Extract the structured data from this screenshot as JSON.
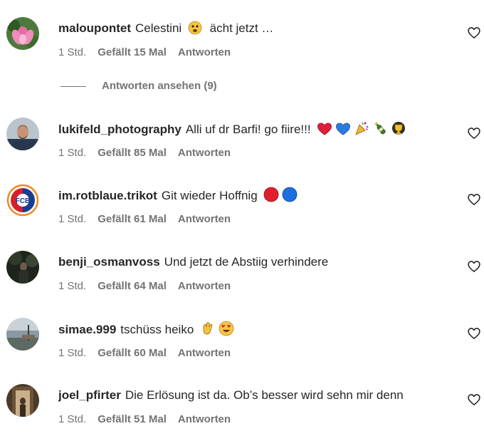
{
  "comments": [
    {
      "username": "maloupontet",
      "text": "Celestini",
      "text_after": "ächt jetzt …",
      "emojis": [
        "upside-down-sad-face"
      ],
      "time": "1 Std.",
      "likes": "Gefällt 15 Mal",
      "reply": "Antworten",
      "avatar": "pink-lotus-flower"
    },
    {
      "username": "lukifeld_photography",
      "text": "Alli uf dr Barfi! go fiire!!!",
      "text_after": "",
      "emojis": [
        "red-heart",
        "blue-heart",
        "party-popper",
        "champagne-bottle",
        "trophy-medal"
      ],
      "time": "1 Std.",
      "likes": "Gefällt 85 Mal",
      "reply": "Antworten",
      "avatar": "man-portrait"
    },
    {
      "username": "im.rotblaue.trikot",
      "text": "Git wieder Hoffnig",
      "text_after": "",
      "emojis": [
        "red-circle",
        "blue-circle"
      ],
      "time": "1 Std.",
      "likes": "Gefällt 61 Mal",
      "reply": "Antworten",
      "avatar": "fcb-crest"
    },
    {
      "username": "benji_osmanvoss",
      "text": "Und jetzt de Abstiig verhindere",
      "text_after": "",
      "emojis": [],
      "time": "1 Std.",
      "likes": "Gefällt 64 Mal",
      "reply": "Antworten",
      "avatar": "dark-figure"
    },
    {
      "username": "simae.999",
      "text": "tschüss heiko",
      "text_after": "",
      "emojis": [
        "waving-hand",
        "heart-eyes-face"
      ],
      "time": "1 Std.",
      "likes": "Gefällt 60 Mal",
      "reply": "Antworten",
      "avatar": "landscape-photo"
    },
    {
      "username": "joel_pfirter",
      "text": "Die Erlösung ist da. Ob’s besser wird sehn mir denn",
      "text_after": "",
      "emojis": [],
      "time": "1 Std.",
      "likes": "Gefällt 51 Mal",
      "reply": "Antworten",
      "avatar": "doorway-photo"
    }
  ],
  "view_replies": "Antworten ansehen (9)",
  "colors": {
    "meta": "#737373",
    "text": "#262626"
  }
}
